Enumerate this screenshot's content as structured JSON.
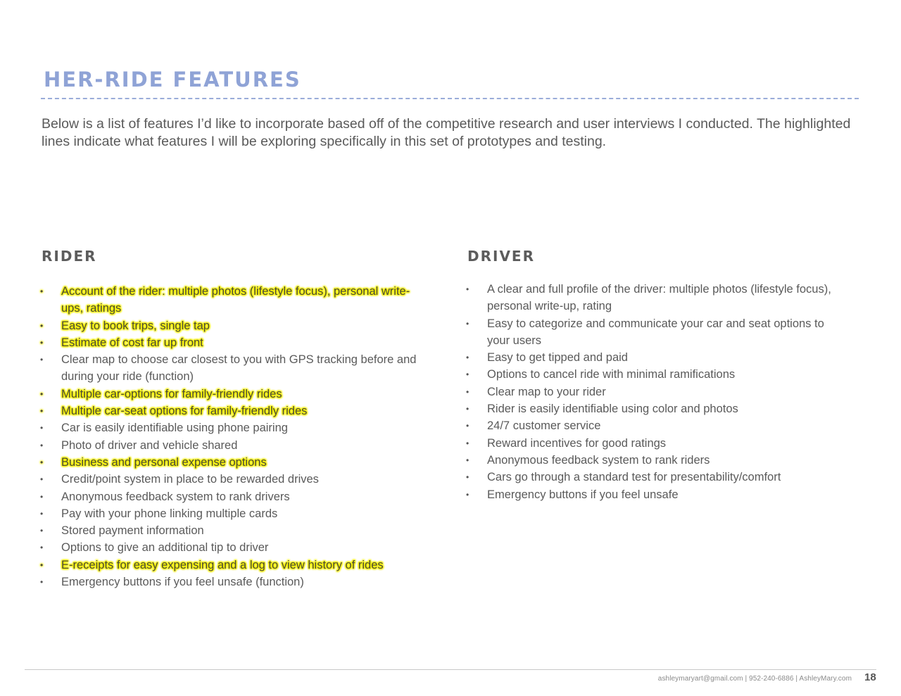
{
  "header": {
    "title": "HER-RIDE FEATURES",
    "intro": "Below is a list of features I’d like to incorporate based off of the competitive research and user interviews I conducted. The highlighted lines indicate what features I will be exploring specifically in this set of prototypes and testing."
  },
  "colors": {
    "title": "#8fa3d6",
    "highlight": "#f6f000",
    "body_text": "#5a5a5a"
  },
  "rider": {
    "heading": "RIDER",
    "items": [
      {
        "text": "Account of the rider: multiple photos (lifestyle focus), personal write-ups, ratings",
        "highlighted": true
      },
      {
        "text": "Easy to book trips, single tap",
        "highlighted": true
      },
      {
        "text": "Estimate of cost far up front",
        "highlighted": true
      },
      {
        "text": "Clear map to choose car closest to you with GPS tracking before and during your ride (function)",
        "highlighted": false
      },
      {
        "text": "Multiple car-options for family-friendly rides",
        "highlighted": true
      },
      {
        "text": "Multiple car-seat options for family-friendly rides",
        "highlighted": true
      },
      {
        "text": "Car is easily identifiable using phone pairing",
        "highlighted": false
      },
      {
        "text": "Photo of driver and vehicle shared",
        "highlighted": false
      },
      {
        "text": "Business and personal expense options",
        "highlighted": true
      },
      {
        "text": "Credit/point system in place to be rewarded drives",
        "highlighted": false
      },
      {
        "text": "Anonymous feedback system to rank drivers",
        "highlighted": false
      },
      {
        "text": "Pay with your phone linking multiple cards",
        "highlighted": false
      },
      {
        "text": "Stored payment information",
        "highlighted": false
      },
      {
        "text": "Options to give an additional tip to driver",
        "highlighted": false
      },
      {
        "text": "E-receipts for easy expensing and a log to view history of rides",
        "highlighted": true
      },
      {
        "text": "Emergency buttons if you feel unsafe (function)",
        "highlighted": false
      }
    ]
  },
  "driver": {
    "heading": "DRIVER",
    "items": [
      {
        "text": "A clear and full profile of the driver: multiple photos (lifestyle focus), personal write-up, rating",
        "highlighted": false
      },
      {
        "text": "Easy to categorize and communicate your car and seat options to your users",
        "highlighted": false
      },
      {
        "text": "Easy to get tipped and paid",
        "highlighted": false
      },
      {
        "text": "Options to cancel ride with minimal ramifications",
        "highlighted": false
      },
      {
        "text": "Clear map to your rider",
        "highlighted": false
      },
      {
        "text": "Rider is easily identifiable using color and photos",
        "highlighted": false
      },
      {
        "text": "24/7 customer service",
        "highlighted": false
      },
      {
        "text": "Reward incentives for good ratings",
        "highlighted": false
      },
      {
        "text": "Anonymous feedback system to rank riders",
        "highlighted": false
      },
      {
        "text": "Cars go through a standard test for presentability/comfort",
        "highlighted": false
      },
      {
        "text": "Emergency buttons if you feel unsafe",
        "highlighted": false
      }
    ]
  },
  "footer": {
    "contact": "ashleymaryart@gmail.com | 952-240-6886 | AshleyMary.com",
    "page_number": "18"
  },
  "icons": {
    "bullet": "•"
  }
}
